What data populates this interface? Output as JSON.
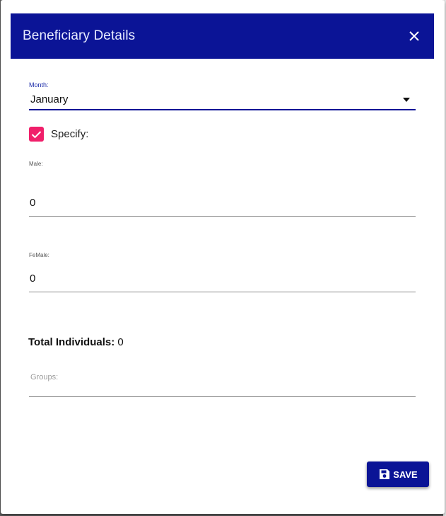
{
  "dialog": {
    "title": "Beneficiary Details",
    "close_icon": "close-icon"
  },
  "month": {
    "label": "Month:",
    "value": "January"
  },
  "specify": {
    "label": "Specify:",
    "checked": true
  },
  "male": {
    "label": "Male:",
    "value": "0"
  },
  "female": {
    "label": "FeMale:",
    "value": "0"
  },
  "total": {
    "label": "Total Individuals:",
    "value": "0"
  },
  "groups": {
    "placeholder": "Groups:"
  },
  "save": {
    "label": "SAVE",
    "icon": "save-icon"
  },
  "colors": {
    "header": "#0b1496",
    "checkbox": "#f01f6a",
    "button": "#0b1496"
  }
}
